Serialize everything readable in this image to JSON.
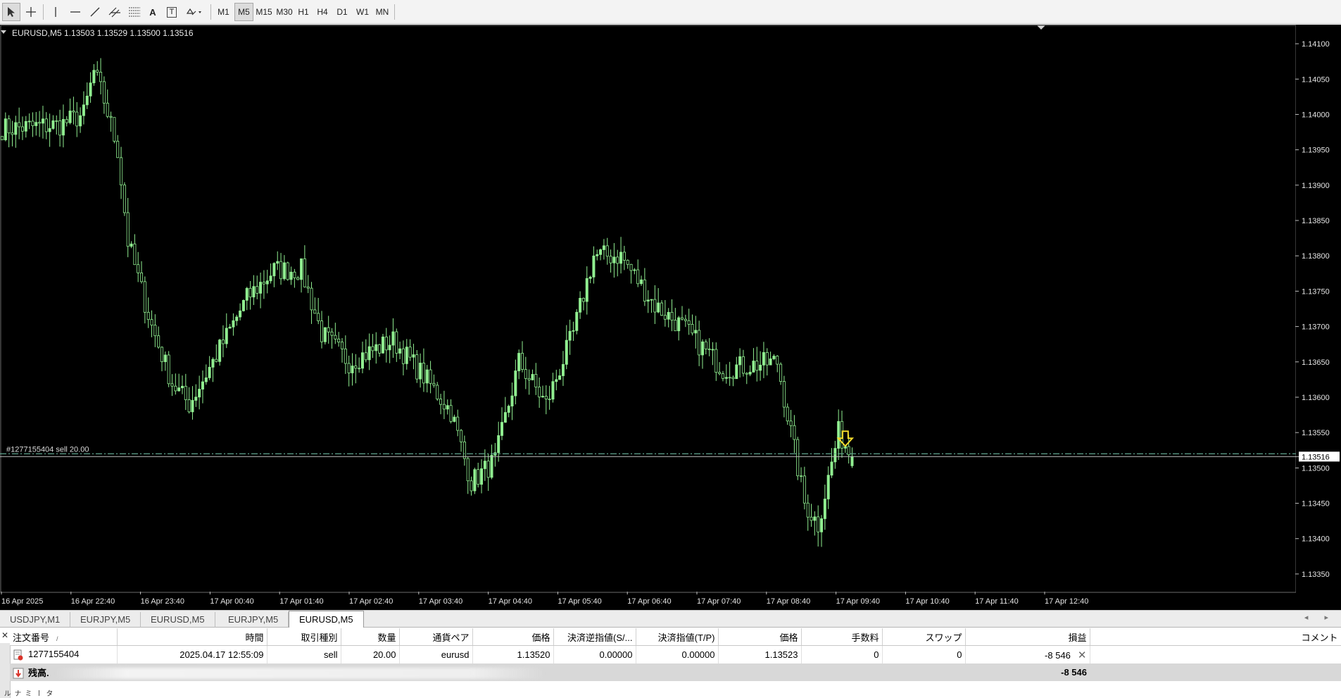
{
  "toolbar": {
    "tools": [
      {
        "name": "cursor-tool-icon"
      },
      {
        "name": "crosshair-tool-icon"
      },
      {
        "name": "vertical-line-tool-icon"
      },
      {
        "name": "horizontal-line-tool-icon"
      },
      {
        "name": "trendline-tool-icon"
      },
      {
        "name": "equidistant-channel-tool-icon"
      },
      {
        "name": "fibonacci-tool-icon"
      },
      {
        "name": "text-tool-icon",
        "label": "A"
      },
      {
        "name": "text-label-tool-icon",
        "label": "T"
      },
      {
        "name": "shapes-dropdown-icon"
      }
    ],
    "timeframes": [
      "M1",
      "M5",
      "M15",
      "M30",
      "H1",
      "H4",
      "D1",
      "W1",
      "MN"
    ],
    "active_timeframe": "M5"
  },
  "chart": {
    "header": "EURUSD,M5  1.13503 1.13529 1.13500 1.13516",
    "order_line_label": "#1277155404 sell 20.00",
    "current_price": "1.13516",
    "colors": {
      "background": "#000000",
      "bull": "#90ee90",
      "bear": "#000000",
      "wick": "#90ee90",
      "order_line": "#5fa58e",
      "bid_line": "#c0c0c0",
      "arrow": "#f4dc2c"
    }
  },
  "chart_data": {
    "type": "candlestick",
    "symbol": "EURUSD",
    "timeframe": "M5",
    "ylim": [
      1.13325,
      1.14125
    ],
    "y_ticks": [
      "1.14100",
      "1.14050",
      "1.14000",
      "1.13950",
      "1.13900",
      "1.13850",
      "1.13800",
      "1.13750",
      "1.13700",
      "1.13650",
      "1.13600",
      "1.13550",
      "1.13516",
      "1.13500",
      "1.13450",
      "1.13400",
      "1.13350"
    ],
    "x_ticks": [
      "16 Apr 2025",
      "16 Apr 22:40",
      "16 Apr 23:40",
      "17 Apr 00:40",
      "17 Apr 01:40",
      "17 Apr 02:40",
      "17 Apr 03:40",
      "17 Apr 04:40",
      "17 Apr 05:40",
      "17 Apr 06:40",
      "17 Apr 07:40",
      "17 Apr 08:40",
      "17 Apr 09:40",
      "17 Apr 10:40",
      "17 Apr 11:40",
      "17 Apr 12:40"
    ],
    "order_price": 1.1352,
    "bid_price": 1.13516,
    "last_ohlc": [
      1.13503,
      1.13529,
      1.135,
      1.13516
    ],
    "anchors": [
      [
        0,
        1.1398
      ],
      [
        17,
        1.13985
      ],
      [
        24,
        1.14
      ],
      [
        27,
        1.1406
      ],
      [
        30,
        1.1402
      ],
      [
        34,
        1.1395
      ],
      [
        37,
        1.1382
      ],
      [
        44,
        1.137
      ],
      [
        50,
        1.1362
      ],
      [
        55,
        1.1359
      ],
      [
        62,
        1.1365
      ],
      [
        72,
        1.1374
      ],
      [
        80,
        1.1378
      ],
      [
        88,
        1.1378
      ],
      [
        94,
        1.1369
      ],
      [
        102,
        1.1365
      ],
      [
        115,
        1.1368
      ],
      [
        124,
        1.1363
      ],
      [
        132,
        1.1358
      ],
      [
        138,
        1.1348
      ],
      [
        145,
        1.1351
      ],
      [
        152,
        1.1365
      ],
      [
        160,
        1.1359
      ],
      [
        168,
        1.1369
      ],
      [
        174,
        1.138
      ],
      [
        182,
        1.138
      ],
      [
        192,
        1.1373
      ],
      [
        200,
        1.137
      ],
      [
        212,
        1.1364
      ],
      [
        228,
        1.1365
      ],
      [
        236,
        1.1345
      ],
      [
        240,
        1.1342
      ],
      [
        246,
        1.1355
      ],
      [
        250,
        1.13516
      ]
    ]
  },
  "tabs": [
    {
      "label": "USDJPY,M1"
    },
    {
      "label": "EURJPY,M5"
    },
    {
      "label": "EURUSD,M5"
    },
    {
      "label": "EURJPY,M5"
    },
    {
      "label": "EURUSD,M5",
      "active": true
    }
  ],
  "tab_nav_arrows": "◂ ▸",
  "terminal": {
    "side_label": "ターミナル",
    "columns": [
      "注文番号",
      "時間",
      "取引種別",
      "数量",
      "通貨ペア",
      "価格",
      "決済逆指値(S/...",
      "決済指値(T/P)",
      "価格",
      "手数料",
      "スワップ",
      "損益",
      "コメント"
    ],
    "sort_mark": "/",
    "orders": [
      {
        "ticket": "1277155404",
        "time": "2025.04.17 12:55:09",
        "type": "sell",
        "volume": "20.00",
        "symbol": "eurusd",
        "price": "1.13520",
        "sl": "0.00000",
        "tp": "0.00000",
        "current": "1.13523",
        "commission": "0",
        "swap": "0",
        "profit": "-8 546",
        "comment": ""
      }
    ],
    "balance": {
      "label": "残高.",
      "profit": "-8 546"
    }
  }
}
